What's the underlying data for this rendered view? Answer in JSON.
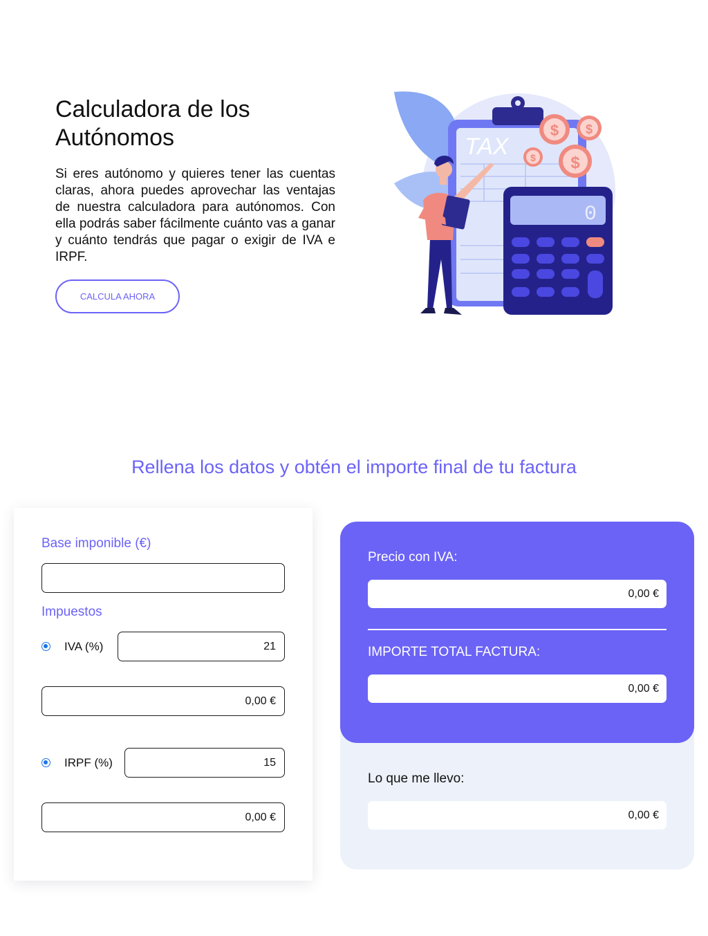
{
  "hero": {
    "title": "Calculadora de los Autónomos",
    "description": "Si eres autónomo y quieres tener las cuentas claras, ahora puedes aprovechar las ventajas de nuestra calculadora para autónomos. Con ella podrás saber fácilmente cuánto vas a ganar y cuánto tendrás que pagar o exigir de IVA e IRPF.",
    "cta_label": "CALCULA AHORA",
    "illustration": {
      "board_text": "TAX",
      "calculator_display": "0",
      "coin_symbol": "$"
    }
  },
  "calculator": {
    "section_title": "Rellena los datos y obtén el importe final de tu factura",
    "base_label": "Base imponible (€)",
    "base_value": "",
    "taxes_label": "Impuestos",
    "iva": {
      "label": "IVA (%)",
      "percent": "21",
      "amount": "0,00 €"
    },
    "irpf": {
      "label": "IRPF (%)",
      "percent": "15",
      "amount": "0,00 €"
    }
  },
  "results": {
    "price_with_iva_label": "Precio con IVA:",
    "price_with_iva_value": "0,00 €",
    "total_label": "IMPORTE TOTAL FACTURA:",
    "total_value": "0,00 €",
    "take_home_label": "Lo que me llevo:",
    "take_home_value": "0,00 €"
  },
  "colors": {
    "accent": "#6b63f6",
    "results_bg": "#edf2fa",
    "illustration_dark": "#2d2b8f",
    "illustration_coin": "#f08a80"
  }
}
